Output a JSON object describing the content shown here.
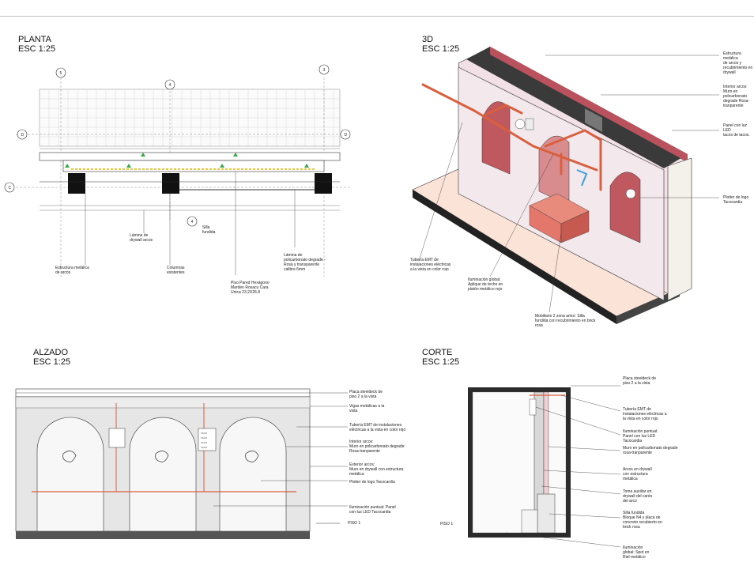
{
  "sections": {
    "planta": {
      "name": "PLANTA",
      "scale": "ESC 1:25"
    },
    "model3d": {
      "name": "3D",
      "scale": "ESC 1:25"
    },
    "alzado": {
      "name": "ALZADO",
      "scale": "ESC 1:25"
    },
    "corte": {
      "name": "CORTE",
      "scale": "ESC 1:25"
    }
  },
  "planta": {
    "grid_bubbles": [
      "5",
      "4",
      "3",
      "D",
      "D",
      "C",
      "4"
    ],
    "notes": {
      "lamina_arcos": "Lámina de\ndrywall arcos",
      "silla": "Silla\nfundida",
      "estructura": "Estructura metálica\nde arcos",
      "columnas": "Columnas\nexistentes",
      "lamina_policarbonato": "Lámina de\npolicarbonato degrade -\nRosa y transparente\ncalibre 6mm",
      "piso": "Piso Pared Hexágono\nMarden Rosacu Cara\nUnica 23.2X26.8"
    }
  },
  "model3d": {
    "notes": {
      "estructura": "Estructura metálica\nde arcos y\nrecubrimiento en\ndrywall",
      "interior": "Interior arcos:\nMuro en\npolicarbonato\ndegrade Rosa-\ntranparente",
      "panel": "Panel con luz LED\ntacos de tacos.",
      "plotter": "Plotter de logo\nTacocardia",
      "tuberia": "Tubería EMT de\ninstalaciones eléctricas\na la vista en color rojo",
      "iluminacion": "Iluminación global:\nAplique de techo en\nplatón metálico rojo",
      "mobiliario": "Mobiliario 2 zona amor: Silla\nfundida con recubrimiento en brick\nrosa"
    }
  },
  "alzado": {
    "notes": {
      "placa": "Placa steeldeck de\npiso 2 a la vista",
      "vigas": "Vigas metálicas a la\nvista",
      "tuberia": "Tubería EMT de instalaciones\neléctricas a la vista en color rojo",
      "interior": "Interior arcos:\nMuro en policarbonato degrade\nRosa-tranparente",
      "exterior": "Exterior arcos:\nMuro en drywall con estructura\nmetálica",
      "plotter": "Plotter de logo Tacocardia",
      "iluminacion": "Iluminación puntual: Panel\ncon luz LED Tacocardia"
    },
    "level": "PISO 1",
    "taco_sign": "TACO"
  },
  "corte": {
    "notes": {
      "placa": "Placa steeldeck de\npiso 2 a la vista",
      "tuberia": "Tubería EMT de\ninstalaciones eléctricas a\nla vista en color rojo",
      "iluminacion_puntual": "Iluminación puntual:\nPanel con luz LED\nTacocardia",
      "muro": "Muro en policarbonato degrade\nrosa-tranparente",
      "arcos": "Arcos en drywall\ncon estructura\nmetálica",
      "toma": "Toma auxiliar en\ndrywall del canto\ndel arco",
      "silla": "Silla fundida\nBloque N4 y placa de\nconcreto recubierto en\nbrick rosa",
      "iluminacion_global": "Iluminación\nglobal: Spot en\nRiel metálico"
    },
    "level": "PISO 1"
  },
  "colors": {
    "pipe_red": "#d9603f",
    "pink_wall": "#f1e1e6",
    "floor_peach": "#fbe3d8",
    "steel_dark": "#2b2b2b",
    "brick": "#e3776b"
  }
}
